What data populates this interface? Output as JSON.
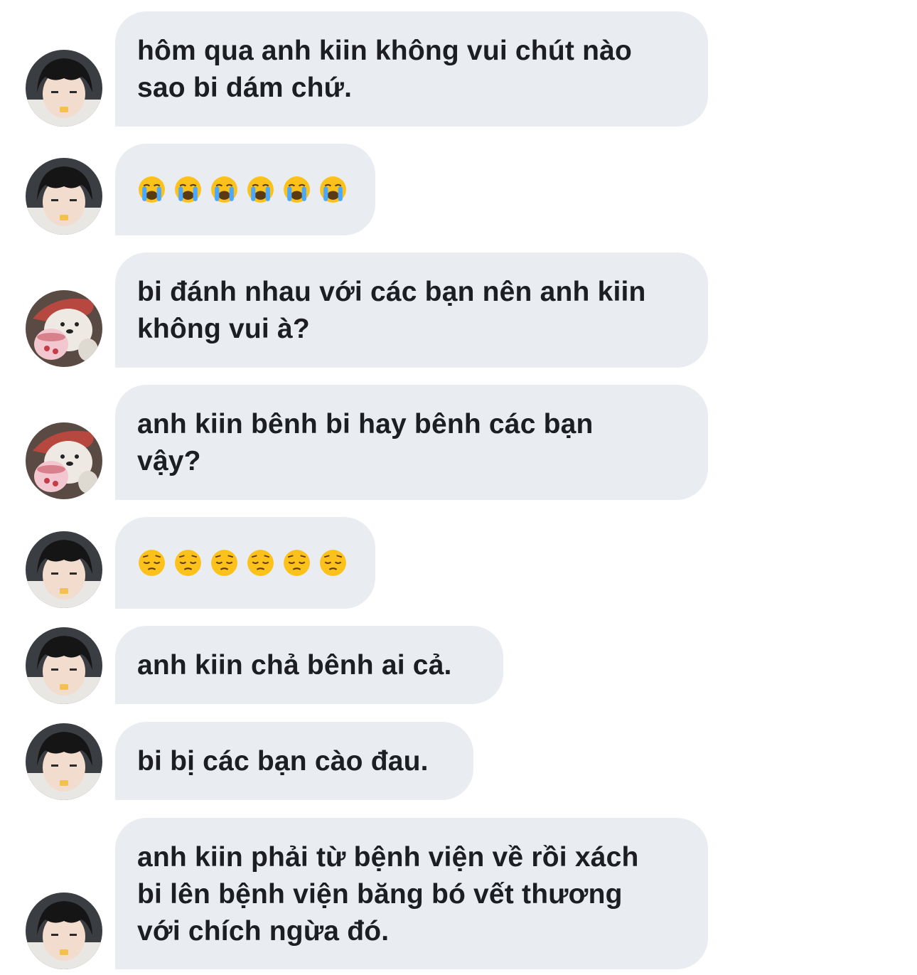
{
  "messages": [
    {
      "sender": "kiin",
      "lines": [
        "hôm qua anh kiin không vui chút nào",
        "sao bi dám chứ."
      ]
    },
    {
      "sender": "kiin",
      "emoji": "loudly-crying-face",
      "emoji_count": 6
    },
    {
      "sender": "bi",
      "lines": [
        "bi đánh nhau với các bạn nên anh kiin",
        "không vui à?"
      ]
    },
    {
      "sender": "bi",
      "lines": [
        "anh kiin bênh bi hay bênh các bạn",
        "vậy?"
      ]
    },
    {
      "sender": "kiin",
      "emoji": "pensive-face",
      "emoji_count": 6
    },
    {
      "sender": "kiin",
      "lines": [
        "anh kiin chả bênh ai cả."
      ]
    },
    {
      "sender": "kiin",
      "lines": [
        "bi bị các bạn cào đau."
      ]
    },
    {
      "sender": "kiin",
      "lines": [
        "anh kiin phải từ bệnh viện về rồi xách",
        "bi lên bệnh viện băng bó vết thương",
        "với chích ngừa đó."
      ]
    }
  ],
  "colors": {
    "bubble": "#e9ecf0",
    "text": "#1c1e21",
    "background": "#ffffff"
  }
}
